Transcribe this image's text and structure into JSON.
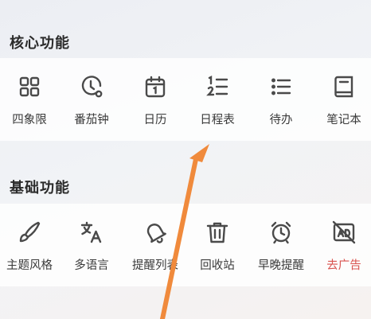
{
  "core": {
    "title": "核心功能",
    "items": [
      {
        "label": "四象限",
        "icon": "grid-four-icon"
      },
      {
        "label": "番茄钟",
        "icon": "clock-timer-icon"
      },
      {
        "label": "日历",
        "icon": "calendar-icon"
      },
      {
        "label": "日程表",
        "icon": "numbered-list-icon"
      },
      {
        "label": "待办",
        "icon": "todo-list-icon"
      },
      {
        "label": "笔记本",
        "icon": "notebook-icon"
      }
    ]
  },
  "basic": {
    "title": "基础功能",
    "items": [
      {
        "label": "主题风格",
        "icon": "paintbrush-icon"
      },
      {
        "label": "多语言",
        "icon": "translate-icon"
      },
      {
        "label": "提醒列表",
        "icon": "bell-icon"
      },
      {
        "label": "回收站",
        "icon": "trash-icon"
      },
      {
        "label": "早晚提醒",
        "icon": "alarm-clock-icon"
      },
      {
        "label": "去广告",
        "icon": "no-ads-icon"
      }
    ]
  },
  "colors": {
    "icon": "#4a4a4a",
    "accent_red": "#d9534f",
    "arrow": "#f08a3c"
  }
}
